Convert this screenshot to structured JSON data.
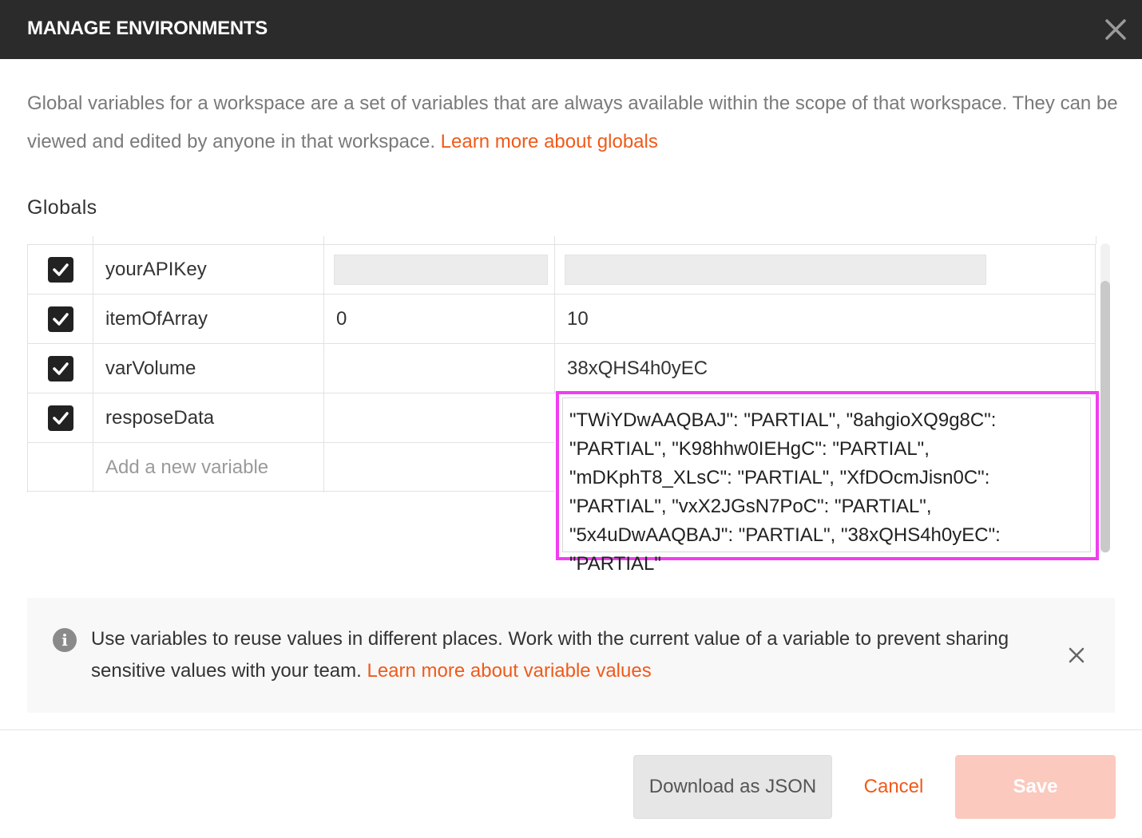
{
  "header": {
    "title": "MANAGE ENVIRONMENTS"
  },
  "intro": {
    "text": "Global variables for a workspace are a set of variables that are always available within the scope of that workspace. They can be viewed and edited by anyone in that workspace.",
    "link": "Learn more about globals"
  },
  "section": {
    "title": "Globals"
  },
  "variables": [
    {
      "key": "yourAPIKey",
      "initial": "",
      "current": "",
      "checked": true
    },
    {
      "key": "itemOfArray",
      "initial": "0",
      "current": "10",
      "checked": true
    },
    {
      "key": "varVolume",
      "initial": "",
      "current": "38xQHS4h0yEC",
      "checked": true
    },
    {
      "key": "resposeData",
      "initial": "",
      "current": "\"TWiYDwAAQBAJ\": \"PARTIAL\", \"8ahgioXQ9g8C\": \"PARTIAL\", \"K98hhw0IEHgC\": \"PARTIAL\", \"mDKphT8_XLsC\": \"PARTIAL\", \"XfDOcmJisn0C\": \"PARTIAL\", \"vxX2JGsN7PoC\": \"PARTIAL\", \"5x4uDwAAQBAJ\": \"PARTIAL\", \"38xQHS4h0yEC\": \"PARTIAL\"",
      "checked": true
    }
  ],
  "new_variable": {
    "placeholder": "Add a new variable"
  },
  "info": {
    "text": "Use variables to reuse values in different places. Work with the current value of a variable to prevent sharing sensitive values with your team.",
    "link": "Learn more about variable values"
  },
  "footer": {
    "download_label": "Download as JSON",
    "cancel_label": "Cancel",
    "save_label": "Save"
  },
  "colors": {
    "header_bg": "#2b2b2b",
    "accent": "#f05a1a",
    "highlight": "#f23df0",
    "save_disabled": "#fbc9bd"
  },
  "icons": {
    "close": "close-icon",
    "check": "check-icon",
    "info": "info-icon"
  }
}
